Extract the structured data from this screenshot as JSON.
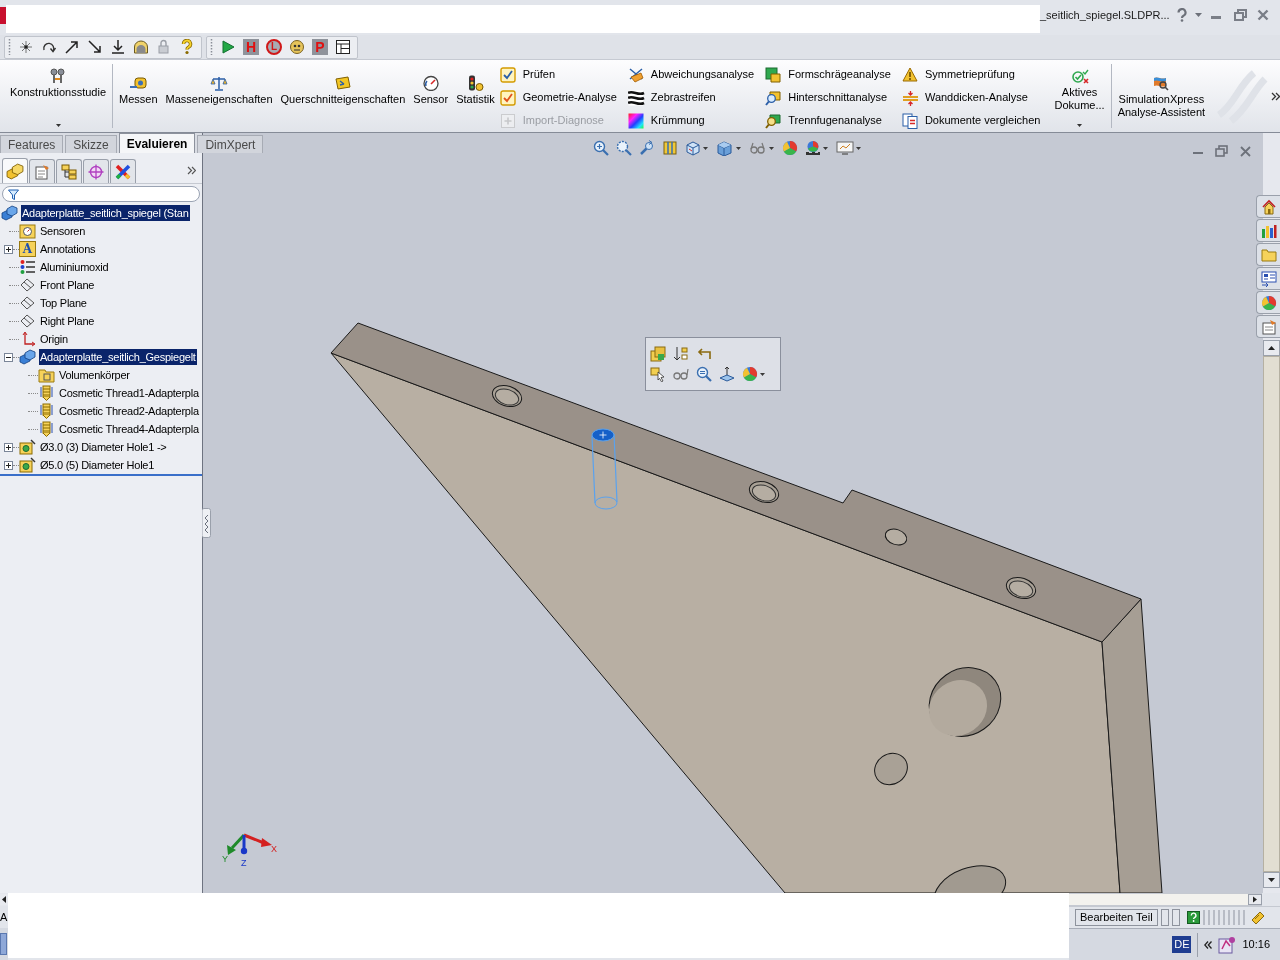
{
  "title_bar": {
    "title": "_seitlich_spiegel.SLDPR..."
  },
  "macro_toolbar": {
    "letter_icons": [
      "H",
      "L",
      "P"
    ]
  },
  "command_manager": {
    "groups": [
      {
        "buttons": [
          {
            "kind": "large",
            "lines": [
              "Konstruktionsstudie"
            ],
            "dropdown": true
          }
        ]
      },
      {
        "buttons": [
          {
            "kind": "large",
            "lines": [
              "Messen"
            ],
            "dropdown": false
          },
          {
            "kind": "large",
            "lines": [
              "Masseneigenschaften"
            ],
            "dropdown": false
          },
          {
            "kind": "large",
            "lines": [
              "Querschnitteigenschaften"
            ],
            "dropdown": false
          },
          {
            "kind": "large",
            "lines": [
              "Sensor"
            ],
            "dropdown": false
          },
          {
            "kind": "large",
            "lines": [
              "Statistik"
            ],
            "dropdown": false
          },
          {
            "kind": "stack",
            "items": [
              {
                "label": "Prüfen",
                "disabled": false
              },
              {
                "label": "Geometrie-Analyse",
                "disabled": false
              },
              {
                "label": "Import-Diagnose",
                "disabled": true
              }
            ]
          },
          {
            "kind": "stack",
            "items": [
              {
                "label": "Abweichungsanalyse",
                "disabled": false
              },
              {
                "label": "Zebrastreifen",
                "disabled": false
              },
              {
                "label": "Krümmung",
                "disabled": false
              }
            ]
          },
          {
            "kind": "stack",
            "items": [
              {
                "label": "Formschrägeanalyse",
                "disabled": false
              },
              {
                "label": "Hinterschnittanalyse",
                "disabled": false
              },
              {
                "label": "Trennfugenanalyse",
                "disabled": false
              }
            ]
          },
          {
            "kind": "stack",
            "items": [
              {
                "label": "Symmetrieprüfung",
                "disabled": false
              },
              {
                "label": "Wanddicken-Analyse",
                "disabled": false
              },
              {
                "label": "Dokumente vergleichen",
                "disabled": false
              }
            ]
          },
          {
            "kind": "large",
            "lines": [
              "Aktives",
              "Dokume..."
            ],
            "dropdown": true
          }
        ]
      },
      {
        "buttons": [
          {
            "kind": "large",
            "lines": [
              "SimulationXpress",
              "Analyse-Assistent"
            ],
            "dropdown": false
          }
        ]
      }
    ]
  },
  "tabs": [
    {
      "label": "Features",
      "selected": false
    },
    {
      "label": "Skizze",
      "selected": false
    },
    {
      "label": "Evaluieren",
      "selected": true
    },
    {
      "label": "DimXpert",
      "selected": false
    }
  ],
  "feature_tree": {
    "items": [
      {
        "label": "Adapterplatte_seitlich_spiegel (Stan",
        "kind": "part",
        "selected": true,
        "children": [
          {
            "label": "Sensoren",
            "kind": "sensor-folder",
            "selected": false
          },
          {
            "label": "Annotations",
            "kind": "annotation-folder",
            "icon_label": "A",
            "selected": false,
            "expanded": false
          },
          {
            "label": "Aluminiumoxid",
            "kind": "material",
            "selected": false
          },
          {
            "label": "Front Plane",
            "kind": "plane",
            "selected": false
          },
          {
            "label": "Top Plane",
            "kind": "plane",
            "selected": false
          },
          {
            "label": "Right Plane",
            "kind": "plane",
            "selected": false
          },
          {
            "label": "Origin",
            "kind": "origin",
            "selected": false
          },
          {
            "label": "Adapterplatte_seitlich_Gespiegelt",
            "kind": "part",
            "selected": true,
            "expanded": true,
            "children": [
              {
                "label": "Volumenkörper",
                "kind": "folder",
                "selected": false
              },
              {
                "label": "Cosmetic Thread1-Adapterpla",
                "kind": "thread",
                "selected": false
              },
              {
                "label": "Cosmetic Thread2-Adapterpla",
                "kind": "thread",
                "selected": false
              },
              {
                "label": "Cosmetic Thread4-Adapterpla",
                "kind": "thread",
                "selected": false
              }
            ]
          },
          {
            "label": "Ø3.0 (3) Diameter Hole1 ->",
            "kind": "hole",
            "selected": false,
            "expanded": false
          },
          {
            "label": "Ø5.0 (5) Diameter Hole1",
            "kind": "hole",
            "selected": false,
            "expanded": false
          }
        ]
      }
    ]
  },
  "viewport": {
    "triad": {
      "axis_labels": [
        "X",
        "Y",
        "Z"
      ]
    }
  },
  "status_bar": {
    "message": "A",
    "mode": "Bearbeiten Teil"
  },
  "taskbar": {
    "language": "DE",
    "clock": "10:16"
  }
}
